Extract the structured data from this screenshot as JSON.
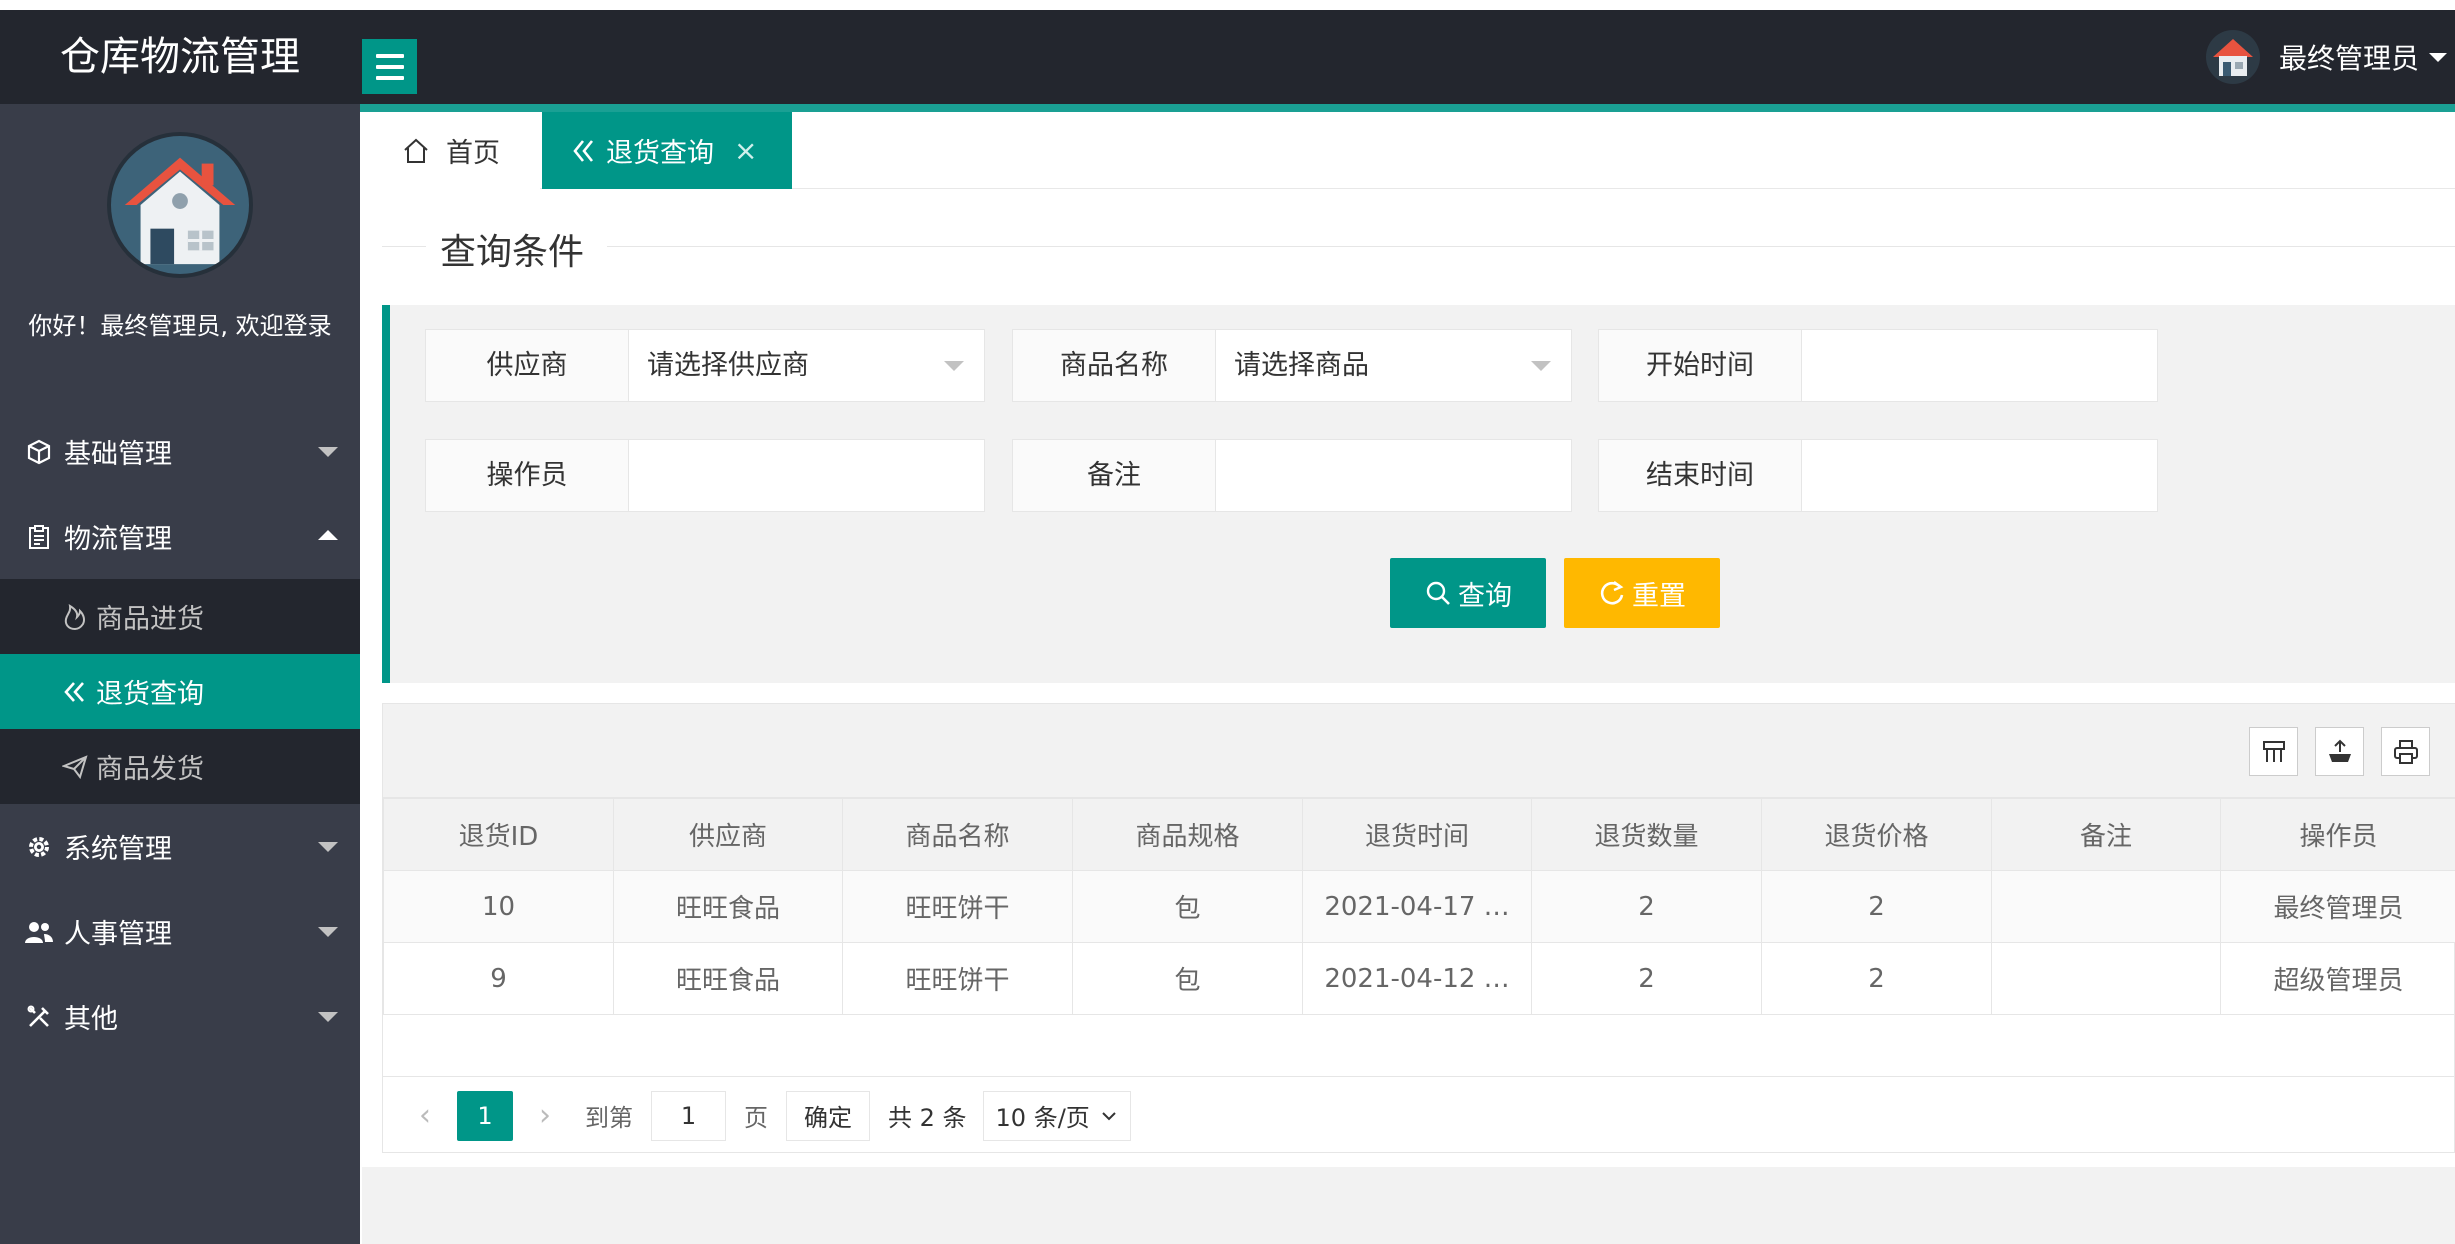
{
  "app": {
    "title": "仓库物流管理",
    "user": "最终管理员"
  },
  "sidebar": {
    "welcome": "你好！最终管理员, 欢迎登录",
    "menus": [
      {
        "label": "基础管理",
        "icon": "cube-icon"
      },
      {
        "label": "物流管理",
        "icon": "clipboard-icon",
        "expanded": true,
        "children": [
          {
            "label": "商品进货",
            "icon": "flame-icon"
          },
          {
            "label": "退货查询",
            "icon": "double-chevron-left-icon",
            "active": true
          },
          {
            "label": "商品发货",
            "icon": "paper-plane-icon"
          }
        ]
      },
      {
        "label": "系统管理",
        "icon": "gear-icon"
      },
      {
        "label": "人事管理",
        "icon": "users-icon"
      },
      {
        "label": "其他",
        "icon": "tools-icon"
      }
    ]
  },
  "tabs": {
    "home": "首页",
    "current": "退货查询",
    "close": "×"
  },
  "query": {
    "section_title": "查询条件",
    "fields": {
      "supplier": {
        "label": "供应商",
        "placeholder": "请选择供应商"
      },
      "product": {
        "label": "商品名称",
        "placeholder": "请选择商品"
      },
      "start_time": {
        "label": "开始时间",
        "value": ""
      },
      "operator": {
        "label": "操作员",
        "value": ""
      },
      "remark": {
        "label": "备注",
        "value": ""
      },
      "end_time": {
        "label": "结束时间",
        "value": ""
      }
    },
    "buttons": {
      "search": "查询",
      "reset": "重置"
    }
  },
  "table": {
    "columns": [
      "退货ID",
      "供应商",
      "商品名称",
      "商品规格",
      "退货时间",
      "退货数量",
      "退货价格",
      "备注",
      "操作员"
    ],
    "rows": [
      [
        "10",
        "旺旺食品",
        "旺旺饼干",
        "包",
        "2021-04-17 …",
        "2",
        "2",
        "",
        "最终管理员"
      ],
      [
        "9",
        "旺旺食品",
        "旺旺饼干",
        "包",
        "2021-04-12 …",
        "2",
        "2",
        "",
        "超级管理员"
      ]
    ]
  },
  "pager": {
    "prev": "‹",
    "next": "›",
    "current": "1",
    "goto_label": "到第",
    "goto_value": "1",
    "page_unit": "页",
    "confirm": "确定",
    "total": "共 2 条",
    "page_size": "10 条/页"
  },
  "colors": {
    "accent": "#009688",
    "warning": "#ffb800",
    "dark": "#23262e",
    "sidebar": "#393d49"
  }
}
